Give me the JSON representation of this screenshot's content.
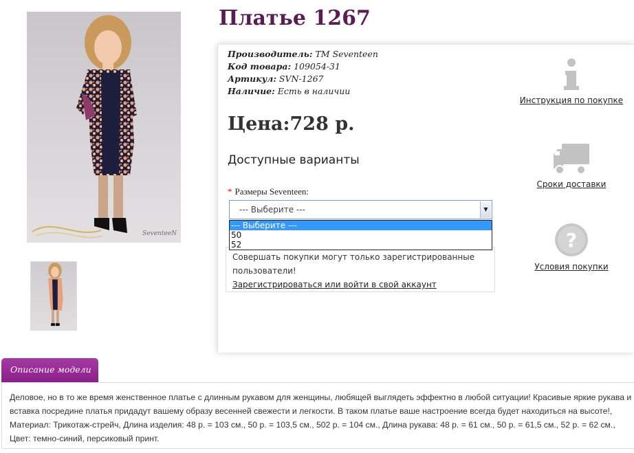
{
  "product": {
    "title": "Платье 1267",
    "images": {
      "watermark": "SeventeeN"
    }
  },
  "info": {
    "manufacturer_label": "Производитель:",
    "manufacturer_value": "ТМ Seventeen",
    "code_label": "Код товара:",
    "code_value": "109054-31",
    "article_label": "Артикул:",
    "article_value": "SVN-1267",
    "stock_label": "Наличие:",
    "stock_value": "Есть в наличии"
  },
  "price": "Цена:728 р.",
  "variants_heading": "Доступные варианты",
  "size": {
    "required_mark": "*",
    "label": "Размеры Seventeen:",
    "selected": "--- Выберите ---",
    "options": [
      "--- Выберите ---",
      "50",
      "52"
    ]
  },
  "notice": {
    "text": "Совершать покупки могут только зарегистрированные пользователи!",
    "link": "Зарегистрироваться или войти в свой аккаунт"
  },
  "side_links": [
    {
      "label": "Инструкция по покупке",
      "icon": "info-icon"
    },
    {
      "label": "Сроки доставки",
      "icon": "truck-icon"
    },
    {
      "label": "Условия покупки",
      "icon": "question-icon"
    }
  ],
  "tab": {
    "label": "Описание модели"
  },
  "description": "Деловое, но в то же время женственное платье с длинным рукавом для женщины, любящей выглядеть эффектно в любой ситуации! Красивые яркие рукава и вставка посредине платья придадут вашему образу весенней свежести и легкости. В таком платье ваше настроение всегда будет находиться на высоте!, Материал: Трикотаж-стрейч, Длина изделия: 48 р. = 103 см., 50 р. = 103,5 см., 502 р. = 104 см., Длина рукава: 48 р. = 61 см., 50 р. = 61,5 см., 52 р. = 62 см., Цвет: темно-синий, персиковый принт.",
  "colors": {
    "title": "#5a1c53",
    "tab": "#8a1f8a",
    "price": "#333333"
  }
}
